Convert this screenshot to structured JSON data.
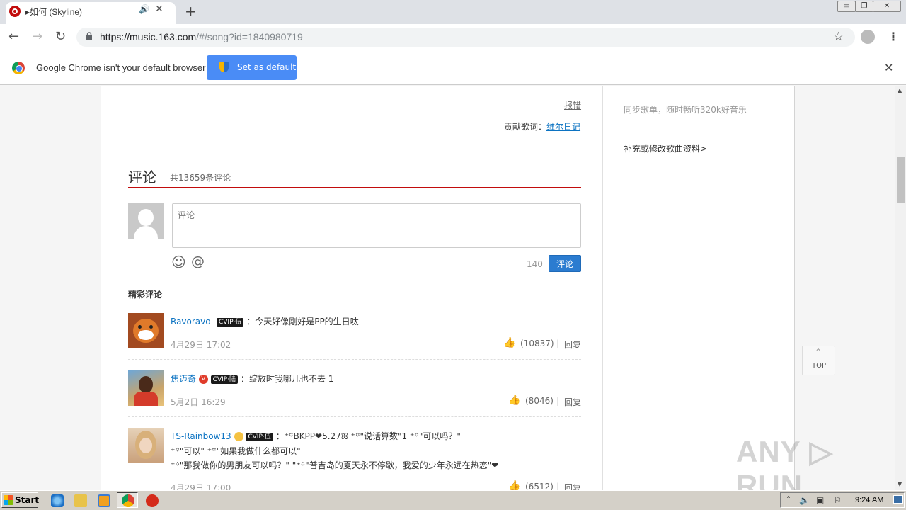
{
  "browser": {
    "tab_title": "▸如何 (Skyline)",
    "url_host": "https://music.163.com",
    "url_path": "/#/song?id=1840980719",
    "infobar_text": "Google Chrome isn't your default browser",
    "set_default_label": "Set as default",
    "close_glyph": "✕",
    "audio_glyph": "🔊",
    "new_tab_glyph": "+",
    "back_glyph": "←",
    "forward_glyph": "→",
    "reload_glyph": "↻",
    "star_glyph": "☆",
    "menu_glyph": "⋮",
    "win_min": "▭",
    "win_restore": "❐",
    "win_close": "✕"
  },
  "lyrics": {
    "report_label": "报错",
    "contributor_label": "贡献歌词：",
    "contributor_name": "维尔日记"
  },
  "sidebar": {
    "sync_text": "同步歌单，随时畅听320k好音乐",
    "edit_link": "补充或修改歌曲资料>"
  },
  "comments": {
    "title": "评论",
    "count_text": "共13659条评论",
    "input_placeholder": "评论",
    "emoji_glyph": "☺",
    "at_glyph": "@",
    "remaining": "140",
    "submit_label": "评论",
    "hot_title": "精彩评论",
    "reply_label": "回复",
    "sep": "|",
    "like_glyph": "👍",
    "items": [
      {
        "user": "Ravoravo-",
        "vip": "CVIP·伍",
        "text": "：今天好像刚好是PP的生日呔",
        "time": "4月29日 17:02",
        "likes": "(10837)"
      },
      {
        "user": "焦迈奇",
        "vip": "CVIP·陆",
        "text": "：绽放时我哪儿也不去 1",
        "time": "5月2日 16:29",
        "likes": "(8046)"
      },
      {
        "user": "TS-Rainbow13",
        "vip": "CVIP·伍",
        "text": "：⁺꙳BKPP❤5.27ꕤ ⁺꙳\"说话算数\"1 ⁺꙳\"可以吗？\"",
        "text2": "⁺꙳\"可以\" ⁺꙳\"如果我做什么都可以\"",
        "text3": "⁺꙳\"那我做你的男朋友可以吗？\" \"⁺꙳\"普吉岛的夏天永不停歇，我爱的少年永远在热恋\"❤",
        "time": "4月29日 17:00",
        "likes": "(6512)"
      }
    ]
  },
  "page": {
    "top_button": "TOP",
    "top_arrow": "⌃",
    "watermark": "ANY ▷ RUN"
  },
  "taskbar": {
    "start_label": "Start",
    "clock": "9:24 AM"
  },
  "colors": {
    "accent_red": "#c20c0c",
    "link_blue": "#0c73c2",
    "button_blue": "#2b7cd0",
    "chrome_blue": "#4a8cf6"
  }
}
